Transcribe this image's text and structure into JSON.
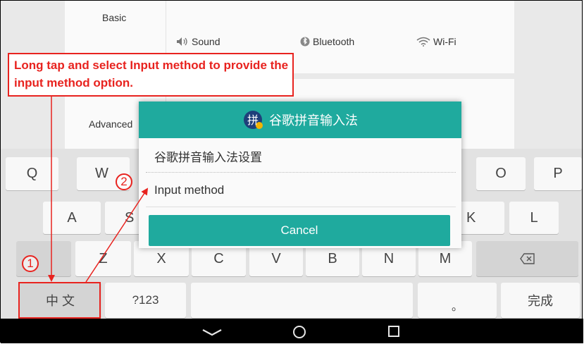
{
  "settings": {
    "basic_label": "Basic",
    "sound_label": "Sound",
    "bluetooth_label": "Bluetooth",
    "wifi_label": "Wi-Fi",
    "advanced_label": "Advanced"
  },
  "dialog": {
    "title": "谷歌拼音输入法",
    "icon_glyph": "拼",
    "item_settings": "谷歌拼音输入法设置",
    "item_input_method": "Input method",
    "cancel": "Cancel"
  },
  "keyboard": {
    "row1": [
      "Q",
      "W",
      "O",
      "P"
    ],
    "row2": [
      "A",
      "S",
      "K",
      "L"
    ],
    "row3": [
      "Z",
      "X",
      "C",
      "V",
      "B",
      "N",
      "M"
    ],
    "lang_key": "中 文",
    "sym_key": "?123",
    "done_key": "完成",
    "period_key": "。",
    "backspace": "⌫"
  },
  "annotation": {
    "callout_text": "Long tap and select Input method to provide the input method option.",
    "step1": "1",
    "step2": "2",
    "color": "#e8231f"
  },
  "colors": {
    "accent": "#1faa9e",
    "annotation": "#e8231f"
  }
}
